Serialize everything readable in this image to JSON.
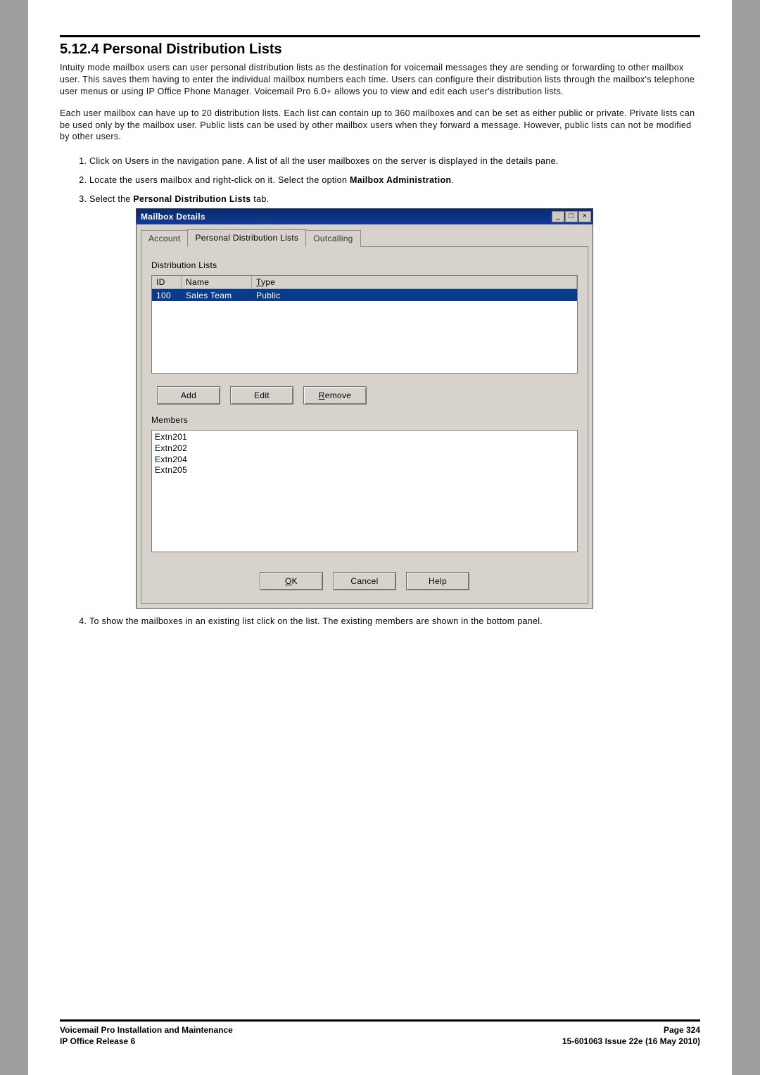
{
  "section": {
    "number": "5.12.4",
    "title": "Personal Distribution Lists"
  },
  "paragraphs": {
    "p1": "Intuity mode mailbox users can user personal distribution lists as the destination for voicemail messages they are sending or forwarding to other mailbox user. This saves them having to enter the individual mailbox numbers each time. Users can configure their distribution lists through the mailbox's telephone user menus or using IP Office Phone Manager. Voicemail Pro 6.0+ allows you to view and edit each user's distribution lists.",
    "p2": "Each user mailbox can have up to 20 distribution lists. Each list can contain up to 360 mailboxes and can be set as either public or private. Private lists can be used only by the mailbox user. Public lists can be used by other mailbox users when they forward a message. However, public lists can not be modified by other users."
  },
  "steps": {
    "s1": "Click on Users in the navigation pane. A list of all the user mailboxes on the server is displayed in the details pane.",
    "s2_prefix": "Locate the users mailbox and right-click on it. Select the option ",
    "s2_bold": "Mailbox Administration",
    "s2_suffix": ".",
    "s3_prefix": "Select the ",
    "s3_bold": "Personal Distribution Lists",
    "s3_suffix": " tab.",
    "s4": "To show the mailboxes in an existing list click on the list. The existing members are shown in the bottom panel."
  },
  "dialog": {
    "title": "Mailbox Details",
    "tabs": {
      "account": "Account",
      "pdl": "Personal Distribution Lists",
      "outcalling": "Outcalling"
    },
    "dist_label": "Distribution Lists",
    "columns": {
      "id": "ID",
      "name": "Name",
      "type": "Type"
    },
    "row": {
      "id": "100",
      "name": "Sales Team",
      "type": "Public"
    },
    "buttons": {
      "add": "Add",
      "edit": "Edit",
      "remove": "Remove"
    },
    "members_label": "Members",
    "members": [
      "Extn201",
      "Extn202",
      "Extn204",
      "Extn205"
    ],
    "bottom": {
      "ok_u": "O",
      "ok_rest": "K",
      "cancel": "Cancel",
      "help": "Help"
    }
  },
  "footer": {
    "left1": "Voicemail Pro Installation and Maintenance",
    "left2": "IP Office Release 6",
    "right1": "Page 324",
    "right2": "15-601063 Issue 22e (16 May 2010)"
  }
}
